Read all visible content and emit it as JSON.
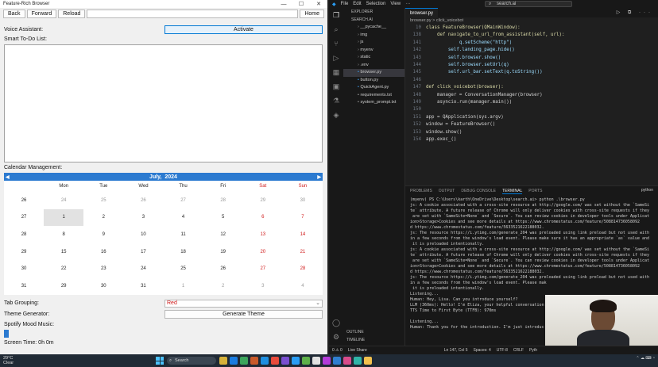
{
  "browser": {
    "title": "Feature-Rich Browser",
    "back_label": "Back",
    "forward_label": "Forward",
    "reload_label": "Reload",
    "home_label": "Home",
    "voice_label": "Voice Assistant:",
    "activate_label": "Activate",
    "todo_label": "Smart To-Do List:",
    "calendar_label": "Calendar Management:",
    "calendar_month": "July,",
    "calendar_year": "2024",
    "weekdays": [
      "Mon",
      "Tue",
      "Wed",
      "Thu",
      "Fri",
      "Sat",
      "Sun"
    ],
    "weeks": [
      {
        "wk": "26",
        "days": [
          "24",
          "25",
          "26",
          "27",
          "28",
          "29",
          "30"
        ]
      },
      {
        "wk": "27",
        "days": [
          "1",
          "2",
          "3",
          "4",
          "5",
          "6",
          "7"
        ]
      },
      {
        "wk": "28",
        "days": [
          "8",
          "9",
          "10",
          "11",
          "12",
          "13",
          "14"
        ]
      },
      {
        "wk": "29",
        "days": [
          "15",
          "16",
          "17",
          "18",
          "19",
          "20",
          "21"
        ]
      },
      {
        "wk": "30",
        "days": [
          "22",
          "23",
          "24",
          "25",
          "26",
          "27",
          "28"
        ]
      },
      {
        "wk": "31",
        "days": [
          "29",
          "30",
          "31",
          "1",
          "2",
          "3",
          "4"
        ]
      }
    ],
    "tab_grouping_label": "Tab Grouping:",
    "tab_grouping_value": "Red",
    "theme_label": "Theme Generator:",
    "theme_button": "Generate Theme",
    "spotify_label": "Spotify Mood Music:",
    "screen_time_label": "Screen Time: 0h 0m"
  },
  "vscode": {
    "menu": [
      "File",
      "Edit",
      "Selection",
      "View"
    ],
    "search": "search.ai",
    "explorer_title": "EXPLORER",
    "project": "SEARCH.AI",
    "files": [
      "__pycache__",
      "img",
      "js",
      "myenv",
      "static",
      ".env",
      "browser.py",
      "button.py",
      "QuickAgent.py",
      "requirements.txt",
      "system_prompt.txt"
    ],
    "outline": "OUTLINE",
    "timeline": "TIMELINE",
    "tab": "browser.py",
    "breadcrumb": "browser.py > click_voicebot",
    "code": [
      {
        "n": "10",
        "t": "class FeatureBrowser(QMainWindow):"
      },
      {
        "n": "138",
        "t": "    def navigate_to_url_from_assistant(self, url):"
      },
      {
        "n": "141",
        "t": "            q.setScheme(\"http\")"
      },
      {
        "n": "142",
        "t": "        self.landing_page.hide()"
      },
      {
        "n": "143",
        "t": "        self.browser.show()"
      },
      {
        "n": "144",
        "t": "        self.browser.setUrl(q)"
      },
      {
        "n": "145",
        "t": "        self.url_bar.setText(q.toString())"
      },
      {
        "n": "146",
        "t": ""
      },
      {
        "n": "147",
        "t": "def click_voicebot(browser):"
      },
      {
        "n": "148",
        "t": "    manager = ConversationManager(browser)"
      },
      {
        "n": "149",
        "t": "    asyncio.run(manager.main())"
      },
      {
        "n": "150",
        "t": ""
      },
      {
        "n": "151",
        "t": "app = QApplication(sys.argv)"
      },
      {
        "n": "152",
        "t": "window = FeatureBrowser()"
      },
      {
        "n": "153",
        "t": "window.show()"
      },
      {
        "n": "154",
        "t": "app.exec_()"
      }
    ],
    "panel_tabs": [
      "PROBLEMS",
      "OUTPUT",
      "DEBUG CONSOLE",
      "TERMINAL",
      "PORTS"
    ],
    "terminal_kind": "python",
    "terminal": [
      "(myenv) PS C:\\Users\\karth\\OneDrive\\Desktop\\search.ai> python .\\browser.py",
      "js: A cookie associated with a cross-site resource at http://google.com/ was set without the `SameSi",
      "te` attribute. A future release of Chrome will only deliver cookies with cross-site requests if they",
      " are set with `SameSite=None` and `Secure`. You can review cookies in developer tools under Applicat",
      "ion>Storage>Cookies and see more details at https://www.chromestatus.com/feature/508814736058092",
      "d https://www.chromestatus.com/feature/5633521622188032.",
      "js: The resource https://i.ytimg.com/generate_204 was preloaded using link preload but not used with",
      "in a few seconds from the window's load event. Please make sure it has an appropriate `as` value and",
      " it is preloaded intentionally.",
      "js: A cookie associated with a cross-site resource at http://google.com/ was set without the `SameSi",
      "te` attribute. A future release of Chrome will only deliver cookies with cross-site requests if they",
      " are set with `SameSite=None` and `Secure`. You can review cookies in developer tools under Applicat",
      "ion>Storage>Cookies and see more details at https://www.chromestatus.com/feature/508814736058092",
      "d https://www.chromestatus.com/feature/5633521622188032.",
      "js: The resource https://i.ytimg.com/generate_204 was preloaded using link preload but not used with",
      "in a few seconds from the window's load event. Please mak",
      " it is preloaded intentionally.",
      "Listening...",
      "Human: Hey, Lisa. Can you introduce yourself?",
      "LLM (360ms): Hello! I'm Eliza, your helpful conversation",
      "TTS Time to First Byte (TTFB): 970ms",
      "",
      "Listening...",
      "Human: Thank you for the introduction. I'm just introduc"
    ],
    "status": [
      "0 ⚠ 0",
      "Live Share",
      "Ln 147, Col 5",
      "Spaces: 4",
      "UTF-8",
      "CRLF",
      "Pyth"
    ]
  },
  "taskbar": {
    "temp": "29°C",
    "weather": "Clear",
    "search": "Search",
    "time": "",
    "icon_colors": [
      "#d7b23a",
      "#1b7ce0",
      "#3ca55c",
      "#c95a2a",
      "#1f8fe0",
      "#e94b3c",
      "#7a4fd0",
      "#2a9df4",
      "#5fb04a",
      "#e0e0e0",
      "#b33bd9",
      "#2f7fd0",
      "#d84b8b",
      "#2fb5a8",
      "#f2c14e"
    ]
  }
}
